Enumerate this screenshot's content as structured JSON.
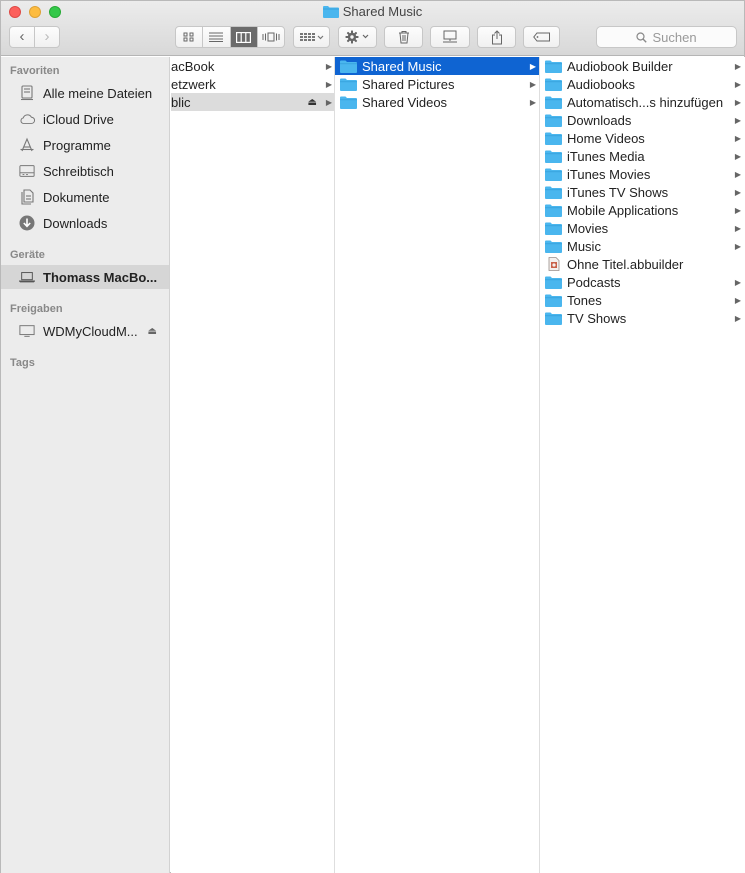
{
  "window": {
    "title": "Shared Music",
    "colors": {
      "selection": "#0f64d2",
      "folder": "#4ab6ee"
    }
  },
  "toolbar": {
    "back_icon": "chevron-left-icon",
    "forward_icon": "chevron-right-icon",
    "search_placeholder": "Suchen"
  },
  "sidebar": {
    "sections": {
      "favorites": "Favoriten",
      "devices": "Geräte",
      "shares": "Freigaben",
      "tags": "Tags"
    },
    "favorites": [
      {
        "label": "Alle meine Dateien",
        "icon": "all-files-icon"
      },
      {
        "label": "iCloud Drive",
        "icon": "cloud-icon"
      },
      {
        "label": "Programme",
        "icon": "applications-icon"
      },
      {
        "label": "Schreibtisch",
        "icon": "desktop-icon"
      },
      {
        "label": "Dokumente",
        "icon": "documents-icon"
      },
      {
        "label": "Downloads",
        "icon": "download-icon"
      }
    ],
    "devices": [
      {
        "label": "Thomass MacBo...",
        "icon": "laptop-icon",
        "selected": true
      }
    ],
    "shares": [
      {
        "label": "WDMyCloudM...",
        "icon": "network-display-icon"
      }
    ]
  },
  "columns": {
    "col1": [
      {
        "label": "acBook"
      },
      {
        "label": "etzwerk"
      },
      {
        "label": "blic",
        "selected_inactive": true
      }
    ],
    "col2": [
      {
        "label": "Shared Music",
        "selected": true
      },
      {
        "label": "Shared Pictures"
      },
      {
        "label": "Shared Videos"
      }
    ],
    "col3": [
      {
        "label": "Audiobook Builder",
        "type": "folder"
      },
      {
        "label": "Audiobooks",
        "type": "folder"
      },
      {
        "label": "Automatisch...s hinzufügen",
        "type": "folder"
      },
      {
        "label": "Downloads",
        "type": "folder"
      },
      {
        "label": "Home Videos",
        "type": "folder"
      },
      {
        "label": "iTunes Media",
        "type": "folder"
      },
      {
        "label": "iTunes Movies",
        "type": "folder"
      },
      {
        "label": "iTunes TV Shows",
        "type": "folder"
      },
      {
        "label": "Mobile Applications",
        "type": "folder"
      },
      {
        "label": "Movies",
        "type": "folder"
      },
      {
        "label": "Music",
        "type": "folder"
      },
      {
        "label": "Ohne Titel.abbuilder",
        "type": "file"
      },
      {
        "label": "Podcasts",
        "type": "folder"
      },
      {
        "label": "Tones",
        "type": "folder"
      },
      {
        "label": "TV Shows",
        "type": "folder"
      }
    ]
  }
}
